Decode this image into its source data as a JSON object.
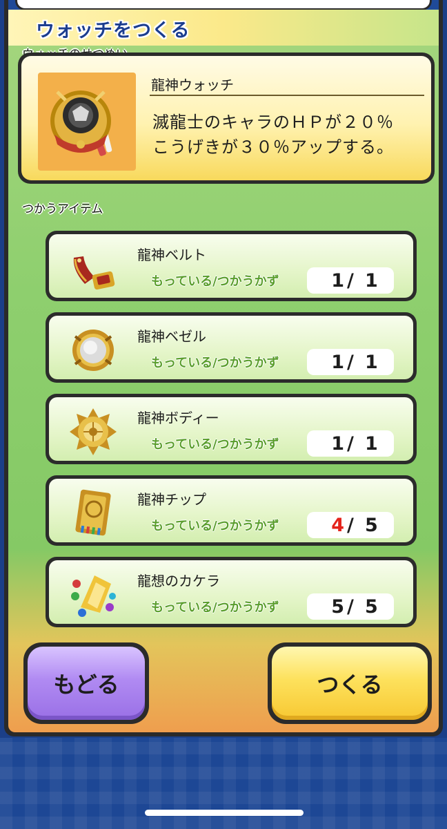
{
  "header": {
    "title": "ウォッチをつくる"
  },
  "description": {
    "section_label": "ウォッチのせつめい",
    "watch_name": "龍神ウォッチ",
    "text_line1": "滅龍士のキャラのＨＰが２０％",
    "text_line2": "こうげきが３０％アップする。"
  },
  "items_section": {
    "label": "つかうアイテム",
    "have_label": "もっている/つかうかず",
    "items": [
      {
        "name": "龍神ベルト",
        "have": "1",
        "need": "1",
        "icon": "belt-icon"
      },
      {
        "name": "龍神ベゼル",
        "have": "1",
        "need": "1",
        "icon": "bezel-icon"
      },
      {
        "name": "龍神ボディー",
        "have": "1",
        "need": "1",
        "icon": "body-icon"
      },
      {
        "name": "龍神チップ",
        "have": "4",
        "need": "5",
        "icon": "chip-icon"
      },
      {
        "name": "龍想のカケラ",
        "have": "5",
        "need": "5",
        "icon": "fragment-icon"
      }
    ],
    "slash": "/"
  },
  "buttons": {
    "back_label": "もどる",
    "make_label": "つくる"
  },
  "colors": {
    "have_label_green": "#5a9e2c",
    "insufficient_red": "#e4231b",
    "header_blue": "#1b3d8f"
  }
}
